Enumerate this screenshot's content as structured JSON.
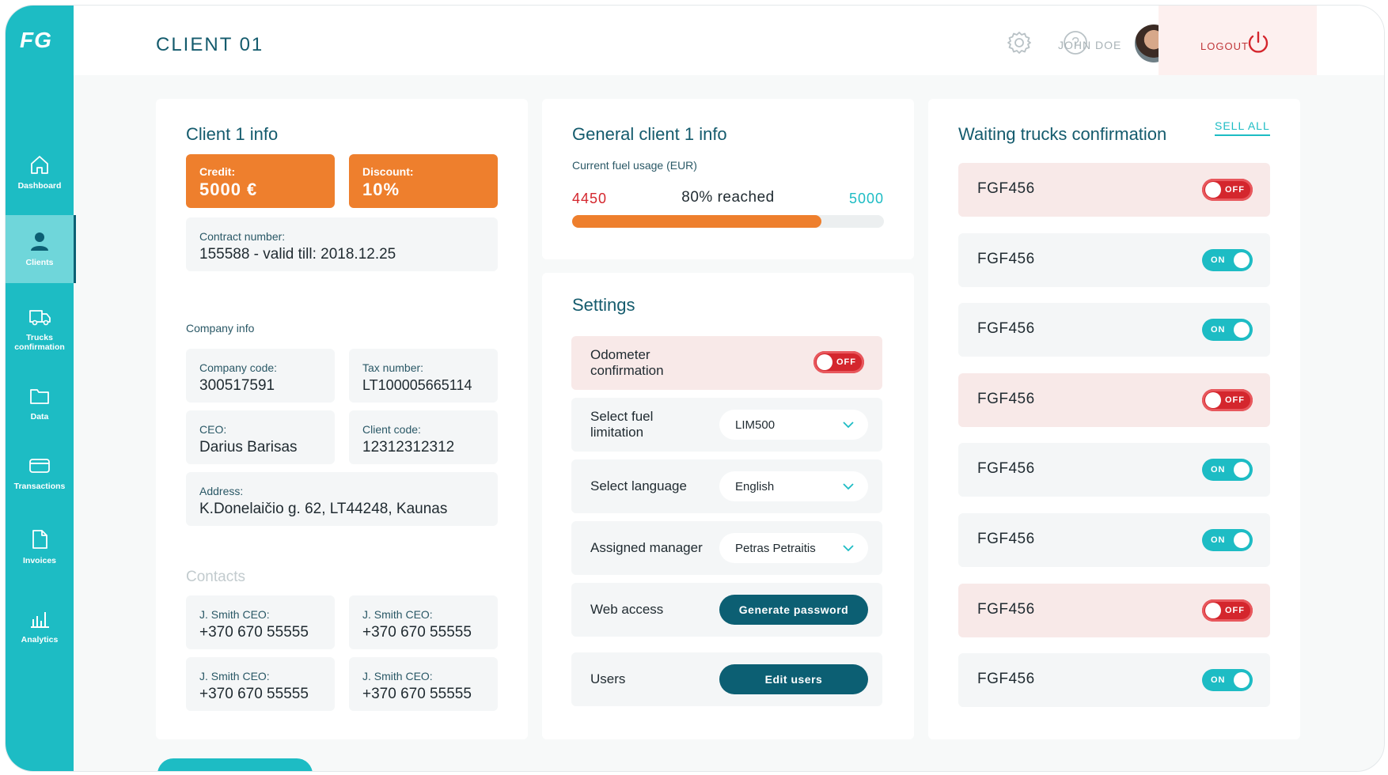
{
  "app": {
    "logo": "FG"
  },
  "sidebar": {
    "items": [
      {
        "label": "Dashboard",
        "icon": "home-icon"
      },
      {
        "label": "Clients",
        "icon": "user-icon",
        "active": true
      },
      {
        "label": "Trucks confirmation",
        "icon": "truck-icon"
      },
      {
        "label": "Data",
        "icon": "folder-icon"
      },
      {
        "label": "Transactions",
        "icon": "credit-card-icon"
      },
      {
        "label": "Invoices",
        "icon": "document-icon"
      },
      {
        "label": "Analytics",
        "icon": "bar-chart-icon"
      }
    ]
  },
  "header": {
    "title": "CLIENT 01",
    "user_name": "JOHN DOE",
    "logout_label": "LOGOUT",
    "help_glyph": "?"
  },
  "client_info": {
    "title": "Client 1 info",
    "credit_label": "Credit:",
    "credit_value": "5000 €",
    "discount_label": "Discount:",
    "discount_value": "10%",
    "contract_label": "Contract number:",
    "contract_value": "155588 - valid till: 2018.12.25",
    "company_heading": "Company info",
    "company_code_label": "Company code:",
    "company_code_value": "300517591",
    "tax_label": "Tax number:",
    "tax_value": "LT100005665114",
    "ceo_label": "CEO:",
    "ceo_value": "Darius Barisas",
    "client_code_label": "Client code:",
    "client_code_value": "12312312312",
    "address_label": "Address:",
    "address_value": "K.Donelaičio g. 62, LT44248, Kaunas",
    "contacts_heading": "Contacts",
    "contacts": [
      {
        "label": "J. Smith CEO:",
        "phone": "+370 670 55555"
      },
      {
        "label": "J. Smith CEO:",
        "phone": "+370 670 55555"
      },
      {
        "label": "J. Smith CEO:",
        "phone": "+370 670 55555"
      },
      {
        "label": "J. Smith CEO:",
        "phone": "+370 670 55555"
      }
    ]
  },
  "general_info": {
    "title": "General client 1 info",
    "fuel_label": "Current fuel usage (EUR)",
    "current": "4450",
    "reached_text": "80% reached",
    "max": "5000",
    "progress_fraction": 0.8
  },
  "settings": {
    "title": "Settings",
    "odometer_label": "Odometer confirmation",
    "odometer_state": "OFF",
    "fuel_limit_label": "Select fuel limitation",
    "fuel_limit_value": "LIM500",
    "language_label": "Select language",
    "language_value": "English",
    "manager_label": "Assigned manager",
    "manager_value": "Petras Petraitis",
    "web_access_label": "Web access",
    "generate_password_label": "Generate password",
    "users_label": "Users",
    "edit_users_label": "Edit users"
  },
  "trucks": {
    "title": "Waiting trucks confirmation",
    "sell_all_label": "SELL ALL",
    "items": [
      {
        "name": "FGF456",
        "state": "OFF"
      },
      {
        "name": "FGF456",
        "state": "ON"
      },
      {
        "name": "FGF456",
        "state": "ON"
      },
      {
        "name": "FGF456",
        "state": "OFF"
      },
      {
        "name": "FGF456",
        "state": "ON"
      },
      {
        "name": "FGF456",
        "state": "ON"
      },
      {
        "name": "FGF456",
        "state": "OFF"
      },
      {
        "name": "FGF456",
        "state": "ON"
      }
    ]
  },
  "colors": {
    "sidebar": "#1dbcc4",
    "accent_dark": "#0c5f73",
    "orange": "#ee7f2d",
    "off_red": "#d4262d"
  }
}
